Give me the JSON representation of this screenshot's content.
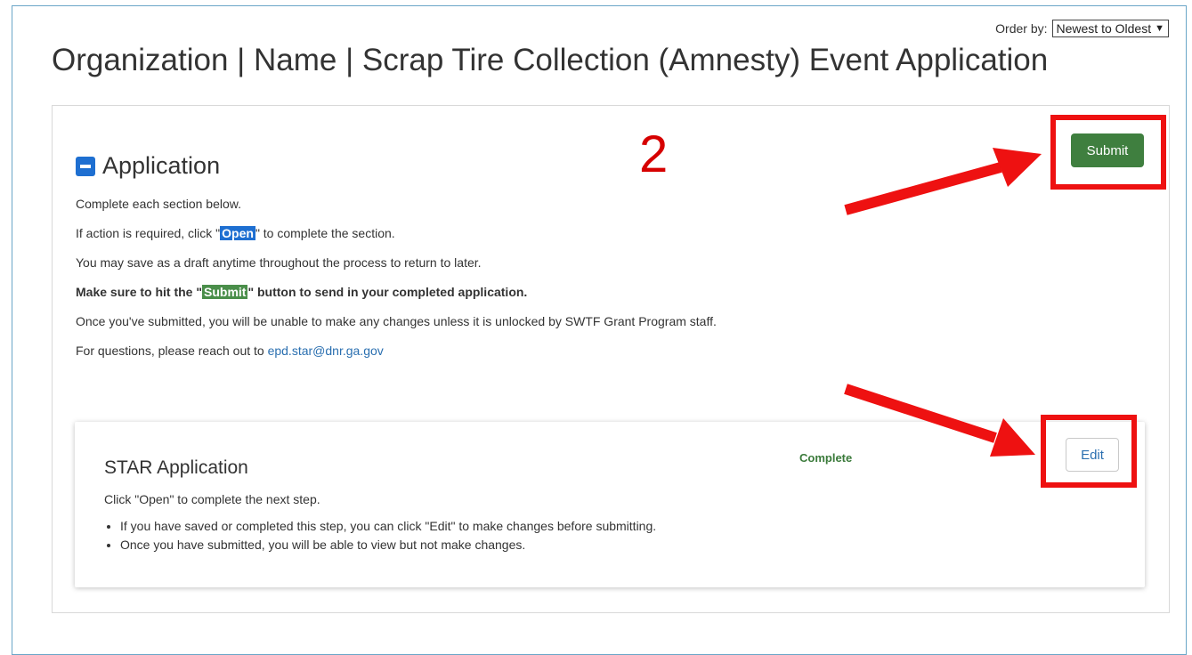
{
  "header": {
    "order_by_label": "Order by:",
    "order_by_value": "Newest to Oldest",
    "page_title": "Organization | Name | Scrap Tire Collection (Amnesty) Event Application"
  },
  "application": {
    "title": "Application",
    "submit_label": "Submit",
    "annotation_step": "2",
    "intro": {
      "line1": "Complete each section below.",
      "line2_pre": "If action is required, click \"",
      "line2_open": "Open",
      "line2_post": "\" to complete the section.",
      "line3": "You may save as a draft anytime throughout the process to return to later.",
      "line4_pre": "Make sure to hit the \"",
      "line4_submit": "Submit",
      "line4_post": "\" button to send in your completed application.",
      "line5": "Once you've submitted, you will be unable to make any changes unless it is unlocked by SWTF Grant Program staff.",
      "line6_pre": "For questions, please reach out to ",
      "line6_email": "epd.star@dnr.ga.gov"
    }
  },
  "star_card": {
    "title": "STAR Application",
    "status": "Complete",
    "edit_label": "Edit",
    "instruction": "Click \"Open\" to complete the next step.",
    "bullets": [
      "If you have saved or completed this step, you can click \"Edit\" to make changes before submitting.",
      "Once you have submitted, you will be able to view but not make changes."
    ]
  },
  "colors": {
    "accent_blue": "#1e6fd1",
    "submit_green": "#3f7f3f",
    "annotation_red": "#ee1111"
  }
}
